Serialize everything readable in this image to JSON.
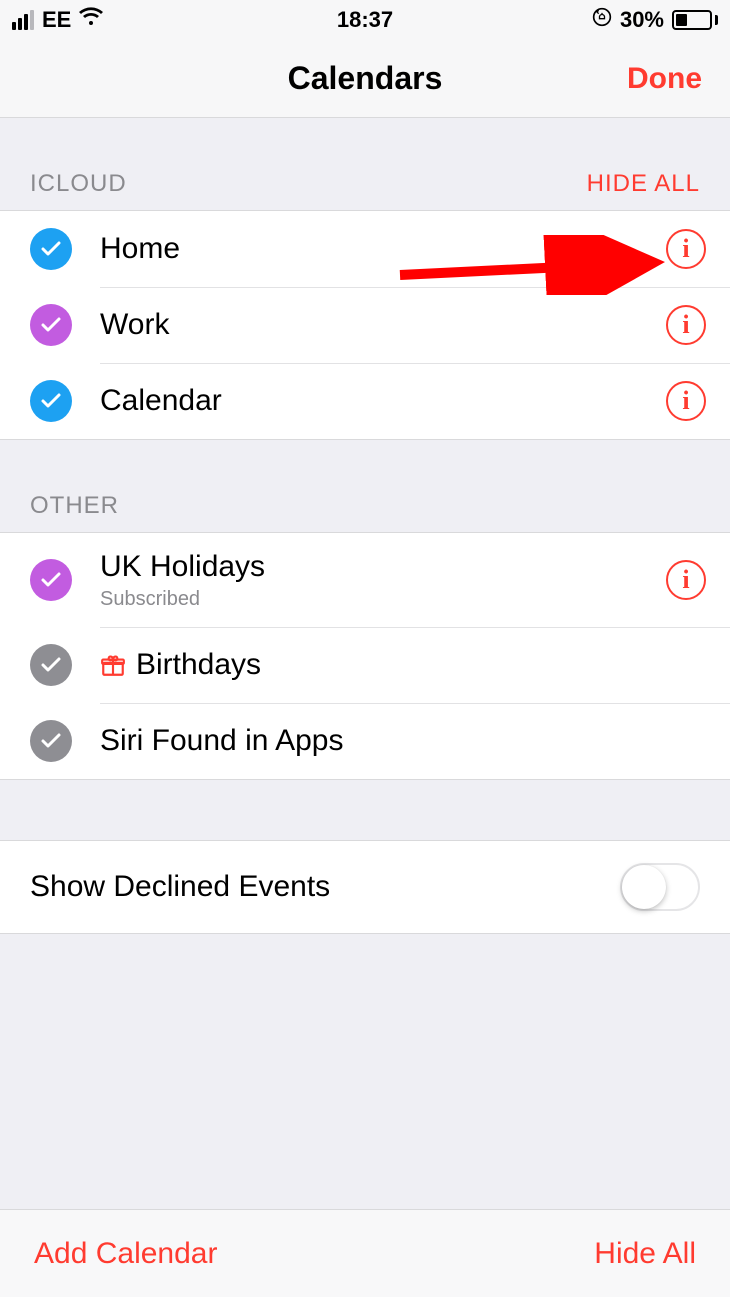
{
  "status": {
    "carrier": "EE",
    "time": "18:37",
    "battery_percent": "30%"
  },
  "nav": {
    "title": "Calendars",
    "done": "Done"
  },
  "sections": {
    "icloud": {
      "header": "ICLOUD",
      "action": "HIDE ALL",
      "items": [
        {
          "label": "Home",
          "color": "#1da1f2",
          "has_info": true
        },
        {
          "label": "Work",
          "color": "#c25ce0",
          "has_info": true
        },
        {
          "label": "Calendar",
          "color": "#1da1f2",
          "has_info": true
        }
      ]
    },
    "other": {
      "header": "OTHER",
      "items": [
        {
          "label": "UK Holidays",
          "sub": "Subscribed",
          "color": "#c25ce0",
          "has_info": true
        },
        {
          "label": "Birthdays",
          "color": "#8e8e93",
          "has_gift": true,
          "has_info": false
        },
        {
          "label": "Siri Found in Apps",
          "color": "#8e8e93",
          "has_info": false
        }
      ]
    }
  },
  "settings": {
    "show_declined": "Show Declined Events",
    "show_declined_on": false
  },
  "toolbar": {
    "add": "Add Calendar",
    "hide_all": "Hide All"
  }
}
